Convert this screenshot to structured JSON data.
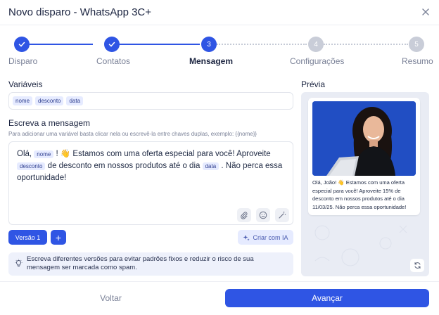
{
  "dialog": {
    "title": "Novo disparo - WhatsApp 3C+",
    "close_icon": "close-icon"
  },
  "stepper": {
    "steps": [
      {
        "number": "1",
        "label": "Disparo",
        "state": "done"
      },
      {
        "number": "2",
        "label": "Contatos",
        "state": "done"
      },
      {
        "number": "3",
        "label": "Mensagem",
        "state": "active"
      },
      {
        "number": "4",
        "label": "Configurações",
        "state": "todo"
      },
      {
        "number": "5",
        "label": "Resumo",
        "state": "todo"
      }
    ]
  },
  "variables": {
    "label": "Variáveis",
    "chips": [
      "nome",
      "desconto",
      "data"
    ]
  },
  "editor": {
    "label": "Escreva a mensagem",
    "hint": "Para adicionar uma variável basta clicar nela ou escrevê-la entre chaves duplas, exemplo: {{nome}}",
    "text_parts": {
      "p1": "Olá,",
      "var1": "nome",
      "p2": "! 👋  Estamos com uma oferta especial para você! Aproveite",
      "var2": "desconto",
      "p3": "de desconto em nossos produtos até o dia",
      "var3": "data",
      "p4": ". Não perca essa oportunidade!"
    },
    "tools": [
      "paperclip-icon",
      "emoji-icon",
      "magic-wand-icon"
    ]
  },
  "actions": {
    "version_label": "Versão 1",
    "add_label": "+",
    "ai_label": "Criar com IA"
  },
  "tip": {
    "text": "Escreva diferentes versões para evitar padrões fixos e reduzir o risco de sua mensagem ser marcada como spam."
  },
  "preview": {
    "label": "Prévia",
    "message": "Olá, João! 👋  Estamos com uma oferta especial para você! Aproveite 15% de desconto em nossos produtos até o dia 11/03/25. Não perca essa oportunidade!"
  },
  "footer": {
    "back_label": "Voltar",
    "next_label": "Avançar"
  },
  "colors": {
    "accent": "#2f55e4",
    "chip_bg": "#e6ebff",
    "inactive_step": "#c9cdd8"
  }
}
